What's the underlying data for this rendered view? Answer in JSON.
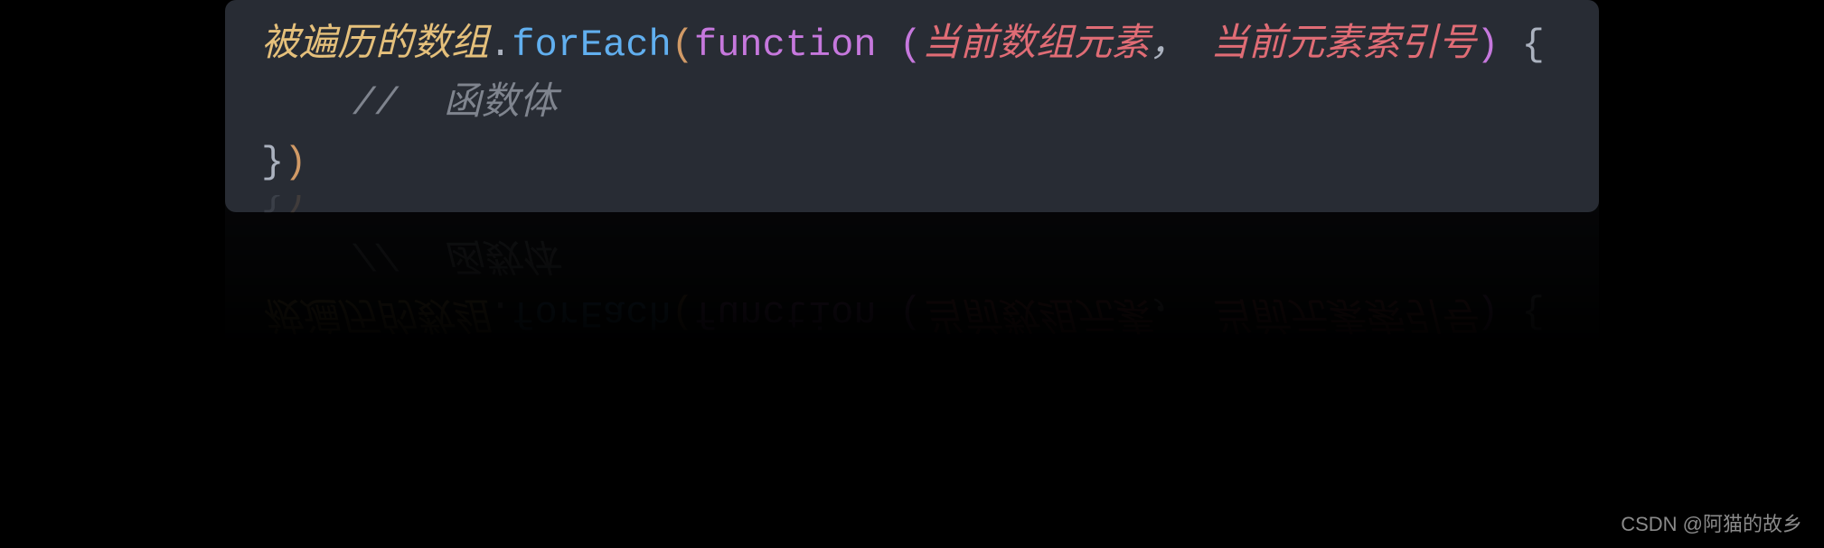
{
  "code": {
    "line1": {
      "array_name": "被遍历的数组",
      "dot": ".",
      "method": "forEach",
      "open_paren": "(",
      "keyword": "function",
      "space1": " ",
      "open_paren2": "(",
      "param1": "当前数组元素",
      "comma": "，",
      "space2": " ",
      "param2": "当前元素索引号",
      "close_paren2": ")",
      "space3": " ",
      "open_brace": "{"
    },
    "line2": {
      "indent": "    ",
      "comment_slash": "//",
      "comment_space": "  ",
      "comment_text": "函数体"
    },
    "line3": {
      "close_brace": "}",
      "close_paren": ")"
    }
  },
  "watermark": "CSDN @阿猫的故乡"
}
